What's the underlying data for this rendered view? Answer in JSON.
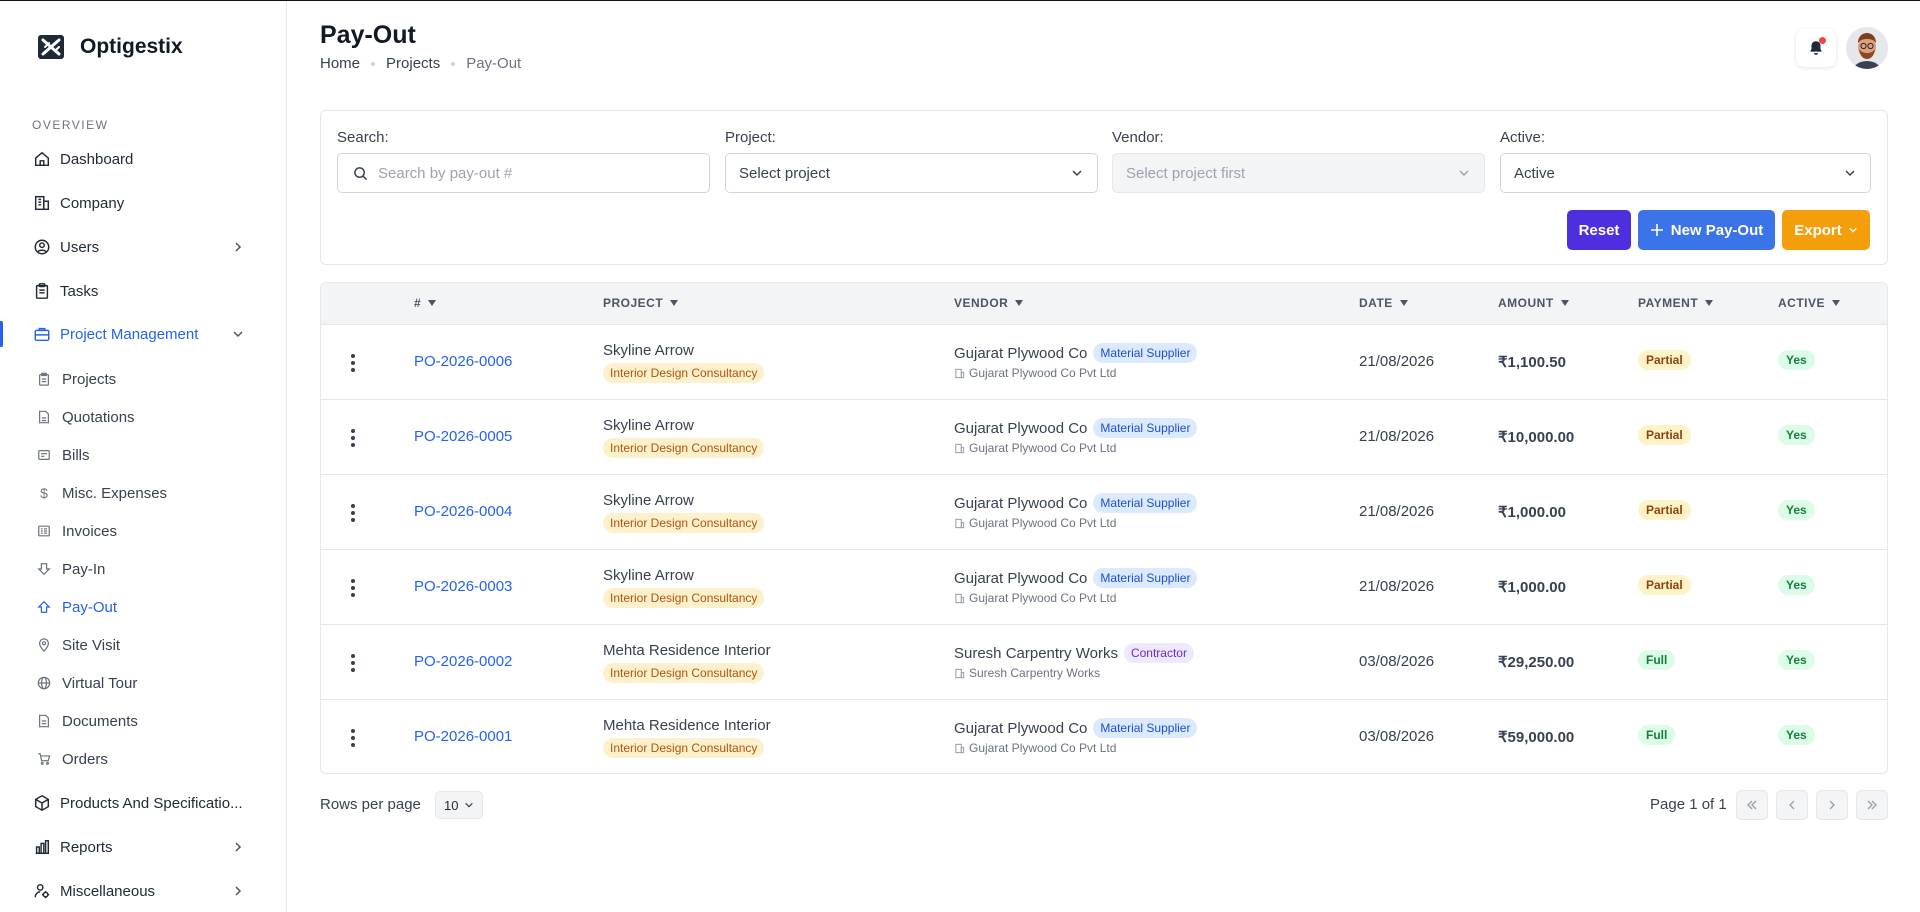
{
  "app": {
    "name": "Optigestix"
  },
  "sidebar": {
    "section_label": "OVERVIEW",
    "items": {
      "dashboard": "Dashboard",
      "company": "Company",
      "users": "Users",
      "tasks": "Tasks",
      "project_management": "Project Management",
      "products": "Products And Specificatio...",
      "reports": "Reports",
      "miscellaneous": "Miscellaneous"
    },
    "sub_items": {
      "projects": "Projects",
      "quotations": "Quotations",
      "bills": "Bills",
      "misc_expenses": "Misc. Expenses",
      "invoices": "Invoices",
      "pay_in": "Pay-In",
      "pay_out": "Pay-Out",
      "site_visit": "Site Visit",
      "virtual_tour": "Virtual Tour",
      "documents": "Documents",
      "orders": "Orders"
    }
  },
  "header": {
    "title": "Pay-Out",
    "breadcrumb": [
      "Home",
      "Projects",
      "Pay-Out"
    ]
  },
  "filters": {
    "search_label": "Search:",
    "search_placeholder": "Search by pay-out #",
    "project_label": "Project:",
    "project_value": "Select project",
    "vendor_label": "Vendor:",
    "vendor_value": "Select project first",
    "active_label": "Active:",
    "active_value": "Active",
    "reset_label": "Reset",
    "new_label": "New Pay-Out",
    "export_label": "Export"
  },
  "table": {
    "columns": [
      "#",
      "PROJECT",
      "VENDOR",
      "DATE",
      "AMOUNT",
      "PAYMENT",
      "ACTIVE"
    ],
    "rows": [
      {
        "id": "PO-2026-0006",
        "project": "Skyline Arrow",
        "project_type": "Interior Design Consultancy",
        "vendor": "Gujarat Plywood Co",
        "vendor_type": "Material Supplier",
        "vendor_company": "Gujarat Plywood Co Pvt Ltd",
        "date": "21/08/2026",
        "amount": "₹1,100.50",
        "payment": "Partial",
        "active": "Yes"
      },
      {
        "id": "PO-2026-0005",
        "project": "Skyline Arrow",
        "project_type": "Interior Design Consultancy",
        "vendor": "Gujarat Plywood Co",
        "vendor_type": "Material Supplier",
        "vendor_company": "Gujarat Plywood Co Pvt Ltd",
        "date": "21/08/2026",
        "amount": "₹10,000.00",
        "payment": "Partial",
        "active": "Yes"
      },
      {
        "id": "PO-2026-0004",
        "project": "Skyline Arrow",
        "project_type": "Interior Design Consultancy",
        "vendor": "Gujarat Plywood Co",
        "vendor_type": "Material Supplier",
        "vendor_company": "Gujarat Plywood Co Pvt Ltd",
        "date": "21/08/2026",
        "amount": "₹1,000.00",
        "payment": "Partial",
        "active": "Yes"
      },
      {
        "id": "PO-2026-0003",
        "project": "Skyline Arrow",
        "project_type": "Interior Design Consultancy",
        "vendor": "Gujarat Plywood Co",
        "vendor_type": "Material Supplier",
        "vendor_company": "Gujarat Plywood Co Pvt Ltd",
        "date": "21/08/2026",
        "amount": "₹1,000.00",
        "payment": "Partial",
        "active": "Yes"
      },
      {
        "id": "PO-2026-0002",
        "project": "Mehta Residence Interior",
        "project_type": "Interior Design Consultancy",
        "vendor": "Suresh Carpentry Works",
        "vendor_type": "Contractor",
        "vendor_company": "Suresh Carpentry Works",
        "date": "03/08/2026",
        "amount": "₹29,250.00",
        "payment": "Full",
        "active": "Yes"
      },
      {
        "id": "PO-2026-0001",
        "project": "Mehta Residence Interior",
        "project_type": "Interior Design Consultancy",
        "vendor": "Gujarat Plywood Co",
        "vendor_type": "Material Supplier",
        "vendor_company": "Gujarat Plywood Co Pvt Ltd",
        "date": "03/08/2026",
        "amount": "₹59,000.00",
        "payment": "Full",
        "active": "Yes"
      }
    ]
  },
  "pagination": {
    "rows_per_page_label": "Rows per page",
    "rows_per_page_value": "10",
    "page_info": "Page 1 of 1"
  },
  "colors": {
    "accent": "#2563eb",
    "reset": "#4f2ee0",
    "new": "#3b74e8",
    "export": "#f59e0b"
  }
}
